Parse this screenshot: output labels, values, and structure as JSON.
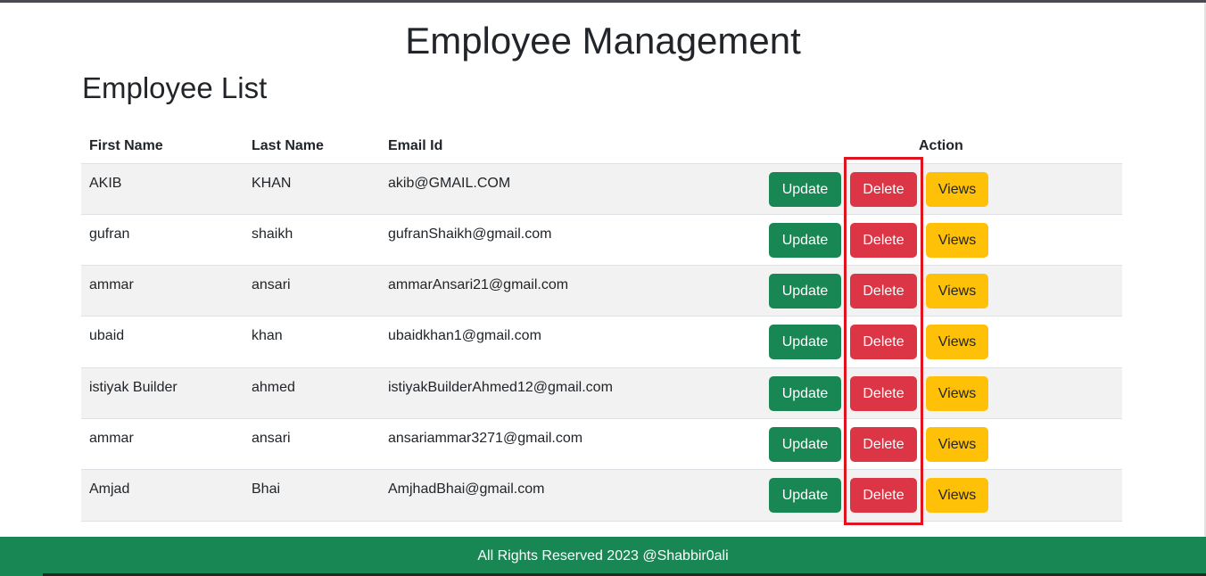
{
  "header": {
    "title": "Employee Management"
  },
  "list": {
    "title": "Employee List"
  },
  "table": {
    "columns": [
      "First Name",
      "Last Name",
      "Email Id",
      "Action"
    ],
    "rows": [
      {
        "first": "AKIB",
        "last": "KHAN",
        "email": "akib@GMAIL.COM"
      },
      {
        "first": "gufran",
        "last": "shaikh",
        "email": "gufranShaikh@gmail.com"
      },
      {
        "first": "ammar",
        "last": "ansari",
        "email": "ammarAnsari21@gmail.com"
      },
      {
        "first": "ubaid",
        "last": "khan",
        "email": "ubaidkhan1@gmail.com"
      },
      {
        "first": "istiyak Builder",
        "last": "ahmed",
        "email": "istiyakBuilderAhmed12@gmail.com"
      },
      {
        "first": "ammar",
        "last": "ansari",
        "email": "ansariammar3271@gmail.com"
      },
      {
        "first": "Amjad",
        "last": "Bhai",
        "email": "AmjhadBhai@gmail.com"
      }
    ],
    "actions": {
      "update": "Update",
      "delete": "Delete",
      "views": "Views"
    }
  },
  "footer": {
    "text": "All Rights Reserved 2023 @Shabbir0ali"
  },
  "colors": {
    "update": "#198754",
    "delete": "#dc3545",
    "views": "#ffc107",
    "footer": "#198754",
    "highlight": "#e0141e"
  }
}
